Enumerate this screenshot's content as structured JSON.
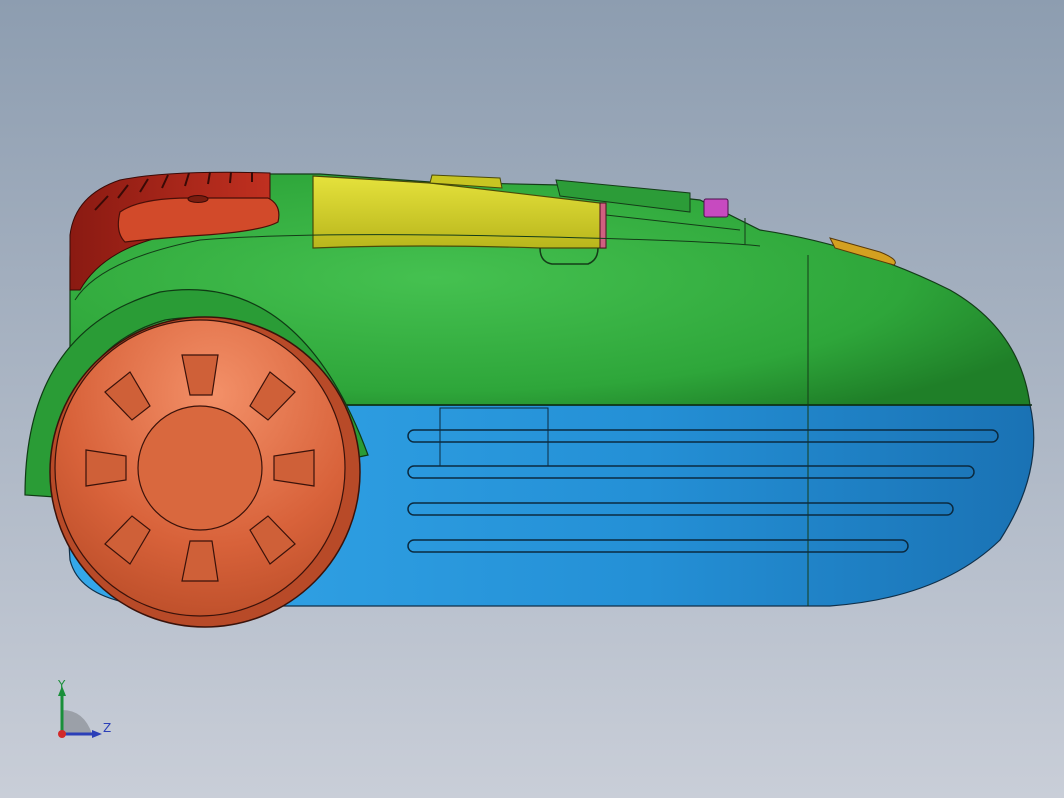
{
  "viewport": {
    "background_top": "#8d9db0",
    "background_bottom": "#c9ced8"
  },
  "model": {
    "description_colors": {
      "upper_shell": "#3bb34a",
      "lower_shell": "#2a93d8",
      "wheel": "#e0643a",
      "top_cover": "#d7d42a",
      "front_bumper": "#d24a2a",
      "button": "#c74ac0",
      "indicator": "#d4a020"
    }
  },
  "triad": {
    "y_label": "Y",
    "z_label": "Z",
    "y_color": "#1a8f3a",
    "z_color": "#2b3fb8",
    "origin_color": "#d22a2a"
  }
}
